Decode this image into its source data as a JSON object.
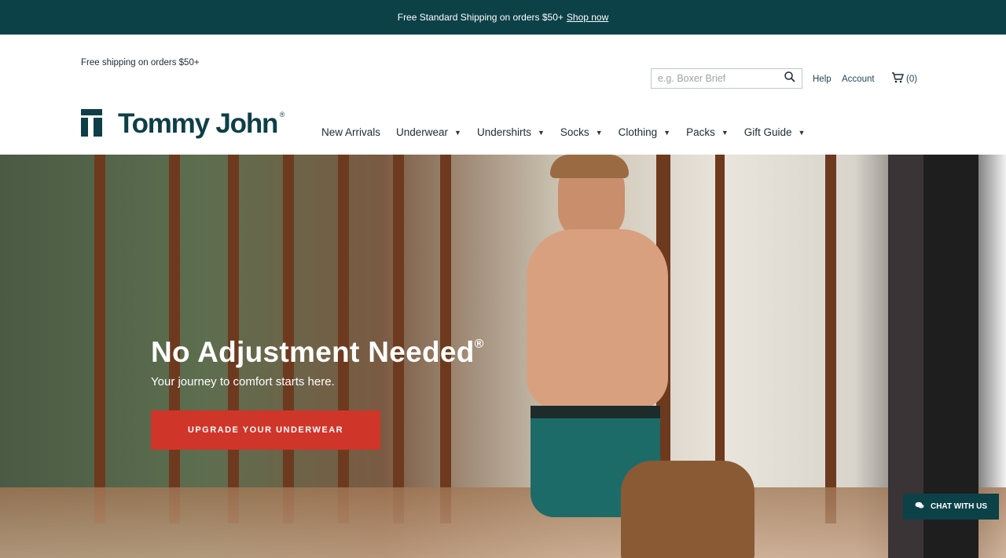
{
  "promo": {
    "text": "Free Standard Shipping on orders $50+",
    "link": "Shop now"
  },
  "header": {
    "shipping_note": "Free shipping on orders $50+",
    "search_placeholder": "e.g. Boxer Brief",
    "help": "Help",
    "account": "Account",
    "cart_count": "(0)",
    "logo_text": "Tommy John",
    "logo_mark": "®"
  },
  "nav": {
    "items": [
      {
        "label": "New Arrivals"
      },
      {
        "label": "Underwear"
      },
      {
        "label": "Undershirts"
      },
      {
        "label": "Socks"
      },
      {
        "label": "Clothing"
      },
      {
        "label": "Packs"
      },
      {
        "label": "Gift Guide"
      }
    ]
  },
  "hero": {
    "title": "No Adjustment Needed",
    "title_mark": "®",
    "subtitle": "Your journey to comfort starts here.",
    "cta": "UPGRADE YOUR UNDERWEAR"
  },
  "chat": {
    "label": "CHAT WITH US"
  },
  "colors": {
    "brand_teal": "#0c4148",
    "cta_red": "#d0352a"
  },
  "icons": [
    "search-icon",
    "cart-icon",
    "chevron-down-icon",
    "chat-bubble-icon"
  ]
}
